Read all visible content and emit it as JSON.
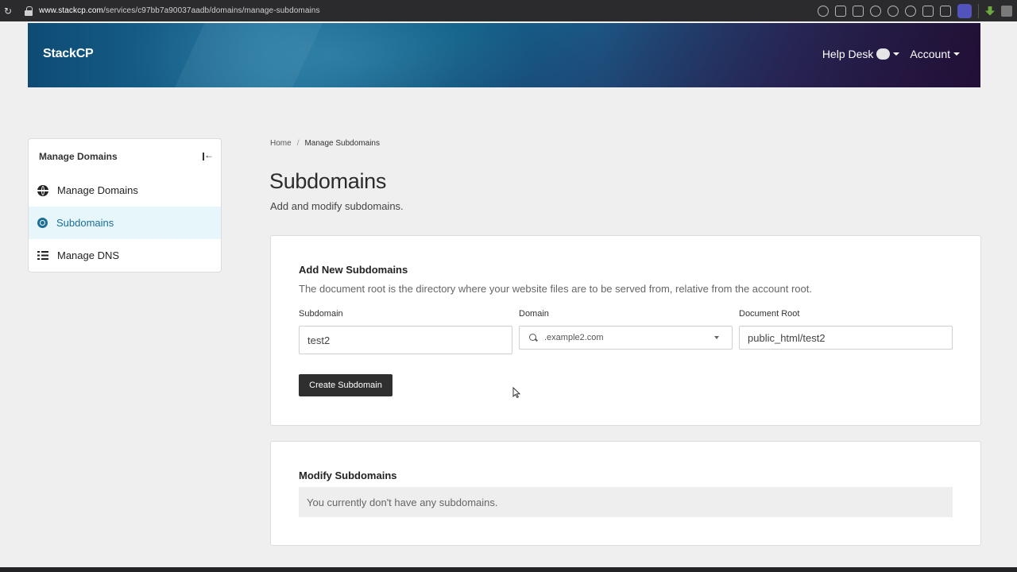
{
  "browser": {
    "url_host": "www.stackcp.com",
    "url_path": "/services/c97bb7a90037aadb/domains/manage-subdomains"
  },
  "header": {
    "logo": "StackCP",
    "help_desk": "Help Desk",
    "account": "Account"
  },
  "sidebar": {
    "title": "Manage Domains",
    "items": [
      {
        "label": "Manage Domains",
        "icon": "globe-icon",
        "active": false
      },
      {
        "label": "Subdomains",
        "icon": "radio-icon",
        "active": true
      },
      {
        "label": "Manage DNS",
        "icon": "list-icon",
        "active": false
      }
    ]
  },
  "breadcrumb": {
    "home": "Home",
    "separator": "/",
    "current": "Manage Subdomains"
  },
  "page": {
    "title": "Subdomains",
    "subtitle": "Add and modify subdomains."
  },
  "add_card": {
    "title": "Add New Subdomains",
    "description": "The document root is the directory where your website files are to be served from, relative from the account root.",
    "subdomain_label": "Subdomain",
    "subdomain_value": "test2",
    "domain_label": "Domain",
    "domain_value": ".example2.com",
    "docroot_label": "Document Root",
    "docroot_value": "public_html/test2",
    "create_button": "Create Subdomain"
  },
  "modify_card": {
    "title": "Modify Subdomains",
    "empty_message": "You currently don't have any subdomains."
  },
  "colors": {
    "accent": "#1a6e98",
    "active_bg": "#e7f6fb",
    "button_bg": "#2f2f2f"
  }
}
